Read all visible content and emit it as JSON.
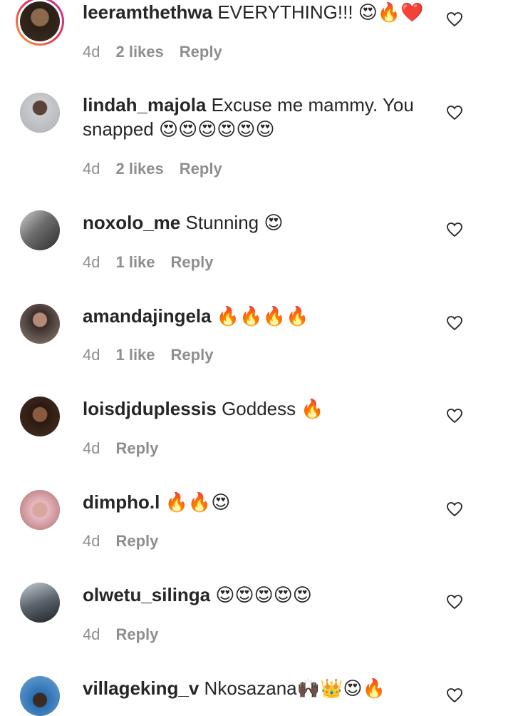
{
  "comments": [
    {
      "username": "leeramthethwa",
      "text": "EVERYTHING!!! 😍🔥❤️",
      "time": "4d",
      "likes": "2 likes",
      "reply": "Reply",
      "avatar_color": "#2b2016",
      "story_ring": true
    },
    {
      "username": "lindah_majola",
      "text": "Excuse me mammy. You snapped 😍😍😍😍😍😍",
      "time": "4d",
      "likes": "2 likes",
      "reply": "Reply",
      "avatar_color": "#b7b9bd",
      "story_ring": false
    },
    {
      "username": "noxolo_me",
      "text": "Stunning 😍",
      "time": "4d",
      "likes": "1 like",
      "reply": "Reply",
      "avatar_color": "#7a7a7a",
      "story_ring": false
    },
    {
      "username": "amandajingela",
      "text": "🔥🔥🔥🔥",
      "time": "4d",
      "likes": "1 like",
      "reply": "Reply",
      "avatar_color": "#6b5a52",
      "story_ring": false
    },
    {
      "username": "loisdjduplessis",
      "text": "Goddess 🔥",
      "time": "4d",
      "likes": "",
      "reply": "Reply",
      "avatar_color": "#3a2418",
      "story_ring": false
    },
    {
      "username": "dimpho.l",
      "text": "🔥🔥😍",
      "time": "4d",
      "likes": "",
      "reply": "Reply",
      "avatar_color": "#c98a86",
      "story_ring": false
    },
    {
      "username": "olwetu_silinga",
      "text": "😍😍😍😍😍",
      "time": "4d",
      "likes": "",
      "reply": "Reply",
      "avatar_color": "#4d5560",
      "story_ring": false
    },
    {
      "username": "villageking_v",
      "text": "Nkosazana🙌🏿👑😍🔥",
      "time": "",
      "likes": "",
      "reply": "",
      "avatar_color": "#2e6fb0",
      "story_ring": false
    }
  ]
}
